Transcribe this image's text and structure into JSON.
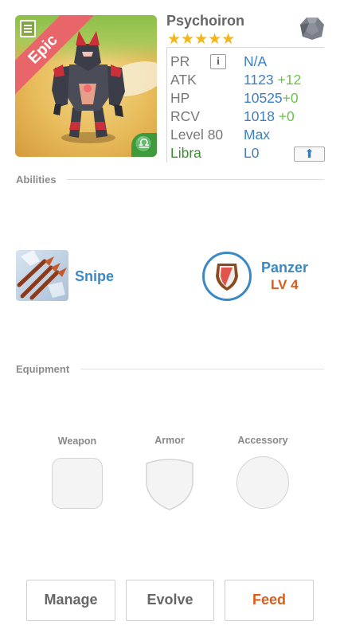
{
  "monster": {
    "name": "Psychoiron",
    "rarity": "Epic",
    "stars": 5,
    "star_glyphs": "★★★★★",
    "element_icon": "rock-element-icon",
    "sign_glyph": "♎"
  },
  "stats": {
    "pr_label": "PR",
    "pr_info": "i",
    "pr_value": "N/A",
    "atk_label": "ATK",
    "atk_value": "1123",
    "atk_bonus": "+12",
    "hp_label": "HP",
    "hp_value": "10525",
    "hp_bonus": "+0",
    "rcv_label": "RCV",
    "rcv_value": "1018",
    "rcv_bonus": "+0",
    "level_label": "Level 80",
    "level_value": "Max",
    "sign_label": "Libra",
    "sign_value": "L0",
    "upgrade_glyph": "⬆"
  },
  "abilities": {
    "header": "Abilities",
    "skill_name": "Snipe",
    "leader_name": "Panzer",
    "leader_level": "LV 4"
  },
  "equipment": {
    "header": "Equipment",
    "weapon_label": "Weapon",
    "armor_label": "Armor",
    "accessory_label": "Accessory"
  },
  "actions": {
    "manage": "Manage",
    "evolve": "Evolve",
    "feed": "Feed"
  },
  "colors": {
    "accent_blue": "#3b7fc4",
    "bonus_green": "#6cc14e",
    "feed_orange": "#dc5b19",
    "star_gold": "#f4b617",
    "epic_ribbon": "#e8666a"
  }
}
